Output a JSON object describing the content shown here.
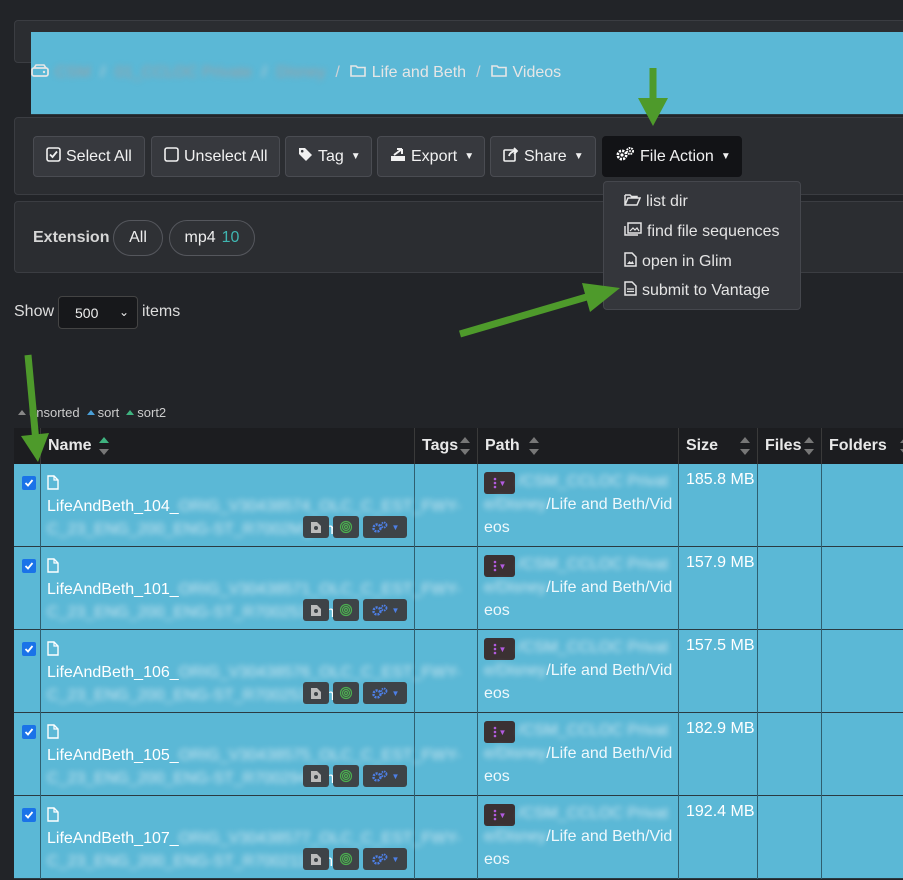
{
  "breadcrumb": {
    "root_blurred": "CSM",
    "seg1_blurred": "01_CCLOC Private",
    "seg2_blurred": "Disney",
    "seg3": "Life and Beth",
    "seg4": "Videos",
    "separator": "/"
  },
  "toolbar": {
    "select_all": "Select All",
    "unselect_all": "Unselect All",
    "tag": "Tag",
    "export": "Export",
    "share": "Share",
    "file_action": "File Action"
  },
  "file_action_menu": {
    "items": [
      "list dir",
      "find file sequences",
      "open in Glim",
      "submit to Vantage"
    ]
  },
  "extension_filter": {
    "label": "Extension",
    "all": "All",
    "mp4": "mp4",
    "mp4_count": "10"
  },
  "show": {
    "label": "Show",
    "value": "500",
    "suffix": "items"
  },
  "sort_legend": {
    "unsorted": "unsorted",
    "sort": "sort",
    "sort2": "sort2"
  },
  "table": {
    "headers": {
      "name": "Name",
      "tags": "Tags",
      "path": "Path",
      "size": "Size",
      "files": "Files",
      "folders": "Folders"
    },
    "rows": [
      {
        "name_start": "LifeAndBeth_104_",
        "name_blur": "ORIG_V30438574_OLC_C_EST_FWY-C_23_ENG_200_ENG-ST_R7002M_",
        "name_end": "2.mp4",
        "path_blur": "/CSM_CCLOC Private/Disney",
        "path_tail": "/Life and Beth/Videos",
        "size": "185.8 MB"
      },
      {
        "name_start": "LifeAndBeth_101_",
        "name_blur": "ORIG_V30438571_OLC_C_EST_FWY-C_23_ENG_200_ENG-ST_R7002537",
        "name_end": ".mp4",
        "path_blur": "/CSM_CCLOC Private/Disney",
        "path_tail": "/Life and Beth/Videos",
        "size": "157.9 MB"
      },
      {
        "name_start": "LifeAndBeth_106_",
        "name_blur": "ORIG_V30438576_OLC_C_EST_FWY-C_23_ENG_200_ENG-ST_R7002533",
        "name_end": ".mp4",
        "path_blur": "/CSM_CCLOC Private/Disney",
        "path_tail": "/Life and Beth/Videos",
        "size": "157.5 MB"
      },
      {
        "name_start": "LifeAndBeth_105_",
        "name_blur": "ORIG_V30438575_OLC_C_EST_FWY-C_23_ENG_200_ENG-ST_R7002943",
        "name_end": ".mp4",
        "path_blur": "/CSM_CCLOC Private/Disney",
        "path_tail": "/Life and Beth/Videos",
        "size": "182.9 MB"
      },
      {
        "name_start": "LifeAndBeth_107_",
        "name_blur": "ORIG_V30438577_OLC_C_EST_FWY-C_23_ENG_200_ENG-ST_R7002117",
        "name_end": ".mp4",
        "path_blur": "/CSM_CCLOC Private/Disney",
        "path_tail": "/Life and Beth/Videos",
        "size": "192.4 MB"
      }
    ]
  },
  "colors": {
    "row_selected": "#5bb8d6",
    "annotation_arrow": "#4e9a2b",
    "count_accent": "#3fb5b0"
  }
}
